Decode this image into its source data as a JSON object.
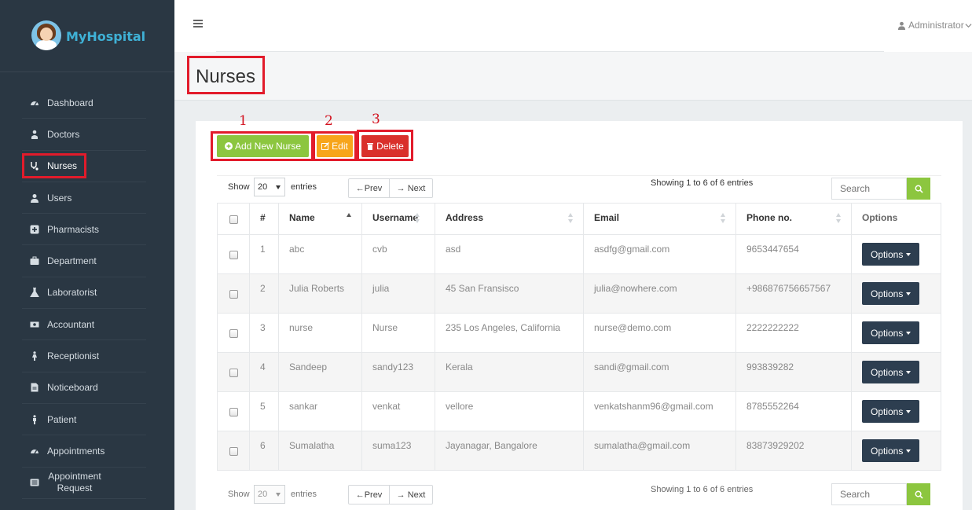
{
  "app": {
    "name": "MyHospital"
  },
  "topbar": {
    "user_label": "Administrator"
  },
  "sidebar": {
    "items": [
      {
        "label": "Dashboard",
        "icon": "dashboard-icon"
      },
      {
        "label": "Doctors",
        "icon": "doctor-icon"
      },
      {
        "label": "Nurses",
        "icon": "stethoscope-icon",
        "active": true
      },
      {
        "label": "Users",
        "icon": "user-icon"
      },
      {
        "label": "Pharmacists",
        "icon": "plus-square-icon"
      },
      {
        "label": "Department",
        "icon": "briefcase-icon"
      },
      {
        "label": "Laboratorist",
        "icon": "flask-icon"
      },
      {
        "label": "Accountant",
        "icon": "money-icon"
      },
      {
        "label": "Receptionist",
        "icon": "female-icon"
      },
      {
        "label": "Noticeboard",
        "icon": "file-icon"
      },
      {
        "label": "Patient",
        "icon": "male-icon"
      },
      {
        "label": "Appointments",
        "icon": "dashboard-icon"
      },
      {
        "label": "Appointment Request",
        "icon": "list-icon"
      }
    ]
  },
  "page": {
    "title": "Nurses"
  },
  "toolbar": {
    "add_label": "Add New Nurse",
    "edit_label": "Edit",
    "delete_label": "Delete",
    "annotations": [
      "1",
      "2",
      "3"
    ]
  },
  "table_controls": {
    "show_label": "Show",
    "entries_value": "20",
    "entries_label": "entries",
    "prev_label": "←Prev",
    "next_label": "→ Next",
    "info": "Showing 1 to 6 of 6 entries",
    "search_placeholder": "Search"
  },
  "table": {
    "columns": [
      "#",
      "Name",
      "Username",
      "Address",
      "Email",
      "Phone no.",
      "Options"
    ],
    "rows": [
      {
        "num": "1",
        "name": "abc",
        "username": "cvb",
        "address": "asd",
        "email": "asdfg@gmail.com",
        "phone": "9653447654",
        "options": "Options"
      },
      {
        "num": "2",
        "name": "Julia Roberts",
        "username": "julia",
        "address": "45 San Fransisco",
        "email": "julia@nowhere.com",
        "phone": "+986876756657567",
        "options": "Options"
      },
      {
        "num": "3",
        "name": "nurse",
        "username": "Nurse",
        "address": "235 Los Angeles, California",
        "email": "nurse@demo.com",
        "phone": "2222222222",
        "options": "Options"
      },
      {
        "num": "4",
        "name": "Sandeep",
        "username": "sandy123",
        "address": "Kerala",
        "email": "sandi@gmail.com",
        "phone": "993839282",
        "options": "Options"
      },
      {
        "num": "5",
        "name": "sankar",
        "username": "venkat",
        "address": "vellore",
        "email": "venkatshanm96@gmail.com",
        "phone": "8785552264",
        "options": "Options"
      },
      {
        "num": "6",
        "name": "Sumalatha",
        "username": "suma123",
        "address": "Jayanagar, Bangalore",
        "email": "sumalatha@gmail.com",
        "phone": "83873929202",
        "options": "Options"
      }
    ]
  },
  "colors": {
    "sidebar_bg": "#2a3743",
    "accent_green": "#8cc63f",
    "accent_orange": "#f7a51b",
    "accent_red": "#d9302b",
    "options_button": "#2d3e50",
    "annotation_red": "#e21b2b"
  }
}
